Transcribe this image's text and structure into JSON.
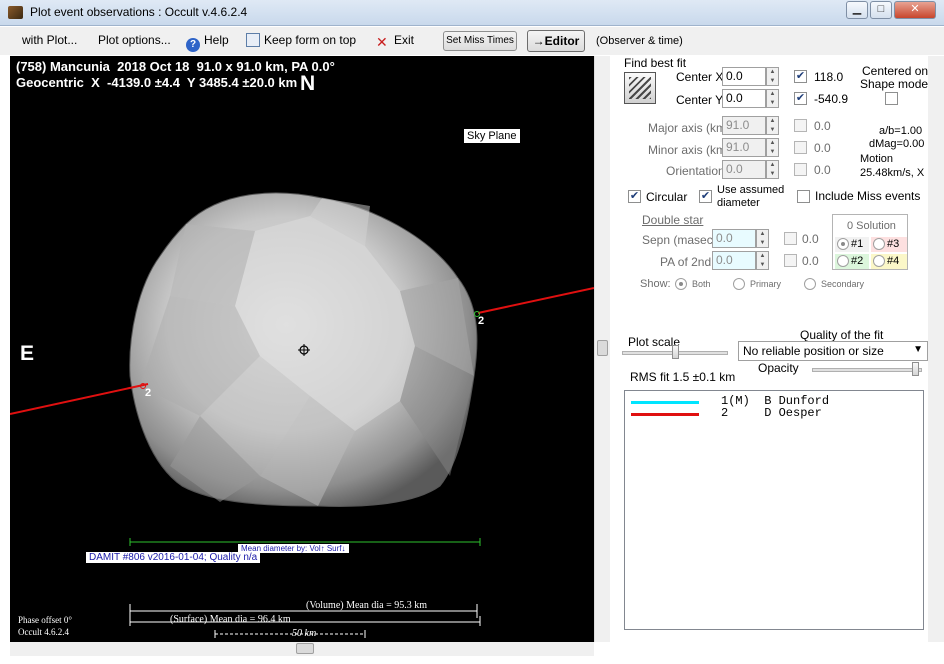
{
  "window": {
    "title": "Plot event observations : Occult v.4.6.2.4",
    "minimize": "▁",
    "maximize": "□",
    "close": "✕"
  },
  "menu": {
    "with_plot": "with Plot...",
    "plot_options": "Plot options...",
    "help": "Help",
    "keep_form": "Keep form on top",
    "exit": "Exit",
    "set_miss_times": "Set Miss Times",
    "editor": "→Editor",
    "observer_time": "(Observer & time)"
  },
  "plot": {
    "header_line1": "(758) Mancunia  2018 Oct 18  91.0 x 91.0 km, PA 0.0°",
    "header_line2": "Geocentric  X  -4139.0 ±4.4  Y 3485.4 ±20.0 km",
    "north": "N",
    "east": "E",
    "sky_plane": "Sky Plane",
    "damit_label": "DAMIT #806 v2016-01-04; Quality n/a",
    "mean_dia_by": "Mean diameter by: Vol↑  Surf↓",
    "phase_offset": "Phase offset 0°",
    "occult_version": "Occult 4.6.2.4",
    "volume_dia": "(Volume) Mean dia = 95.3 km",
    "surface_dia": "(Surface) Mean dia = 96.4 km",
    "scale_km": "50 km",
    "chord_label_a": "2",
    "chord_label_b": "2"
  },
  "fit": {
    "find_best_fit": "Find best fit",
    "center_x_label": "Center X",
    "center_x_value": "0.0",
    "center_x_result": "118.0",
    "center_y_label": "Center Y",
    "center_y_value": "0.0",
    "center_y_result": "-540.9",
    "centered_on": "Centered on",
    "shape_model": "Shape model",
    "major_axis_label": "Major axis (km)",
    "major_axis_value": "91.0",
    "major_axis_result": "0.0",
    "minor_axis_label": "Minor axis (km)",
    "minor_axis_value": "91.0",
    "minor_axis_result": "0.0",
    "orientation_label": "Orientation",
    "orientation_value": "0.0",
    "orientation_result": "0.0",
    "ab_ratio": "a/b=1.00",
    "dmag": "dMag=0.00",
    "motion_label": "Motion",
    "motion_value": "25.48km/s, X",
    "circular": "Circular",
    "use_assumed_1": "Use assumed",
    "use_assumed_2": "diameter",
    "include_miss": "Include Miss events",
    "double_star": "Double star",
    "sepn_label": "Sepn (masec)",
    "sepn_value": "0.0",
    "sepn_result": "0.0",
    "pa2_label": "PA of 2nd",
    "pa2_value": "0.0",
    "pa2_result": "0.0",
    "show_label": "Show:",
    "show_both": "Both",
    "show_primary": "Primary",
    "show_secondary": "Secondary",
    "solution_title": "0 Solution",
    "sol1": "#1",
    "sol2": "#2",
    "sol3": "#3",
    "sol4": "#4",
    "plot_scale": "Plot scale",
    "quality_label": "Quality of the fit",
    "quality_value": "No reliable position or size",
    "opacity": "Opacity",
    "rms_fit": "RMS fit  1.5 ±0.1 km"
  },
  "observers": [
    {
      "text": "1(M)  B Dunford",
      "color": "#00e5ff"
    },
    {
      "text": "2     D Oesper",
      "color": "#e01010"
    }
  ]
}
